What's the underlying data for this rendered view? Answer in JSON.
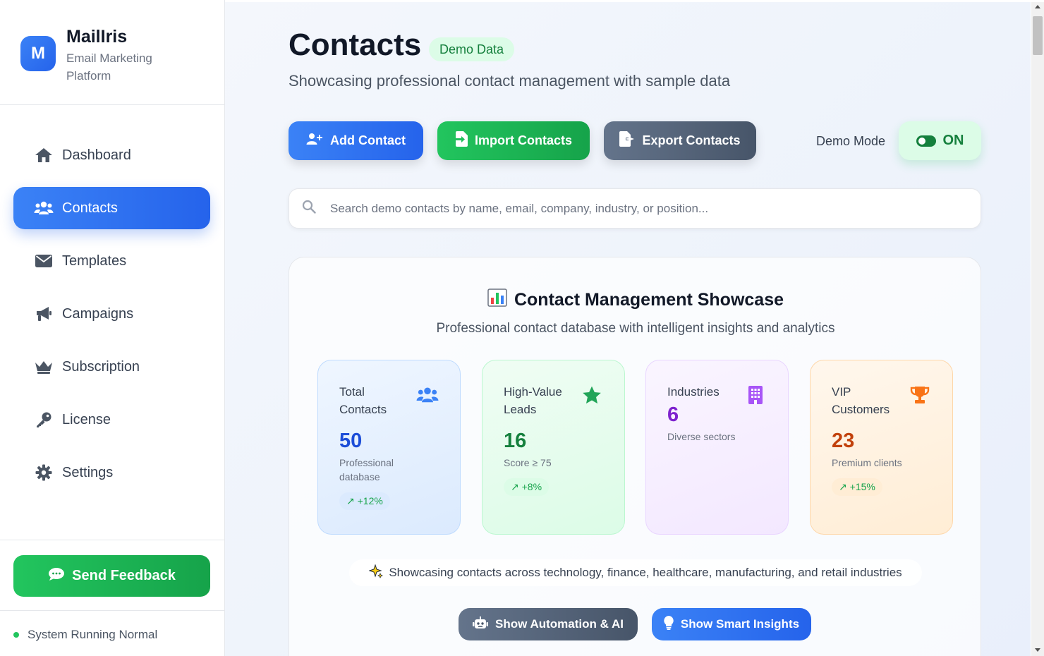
{
  "brand": {
    "logo_letter": "M",
    "name": "MailIris",
    "subtitle": "Email Marketing Platform"
  },
  "sidebar": {
    "items": [
      {
        "label": "Dashboard",
        "icon": "home-icon",
        "active": false
      },
      {
        "label": "Contacts",
        "icon": "users-icon",
        "active": true
      },
      {
        "label": "Templates",
        "icon": "envelope-icon",
        "active": false
      },
      {
        "label": "Campaigns",
        "icon": "megaphone-icon",
        "active": false
      },
      {
        "label": "Subscription",
        "icon": "crown-icon",
        "active": false
      },
      {
        "label": "License",
        "icon": "key-icon",
        "active": false
      },
      {
        "label": "Settings",
        "icon": "gear-icon",
        "active": false
      }
    ],
    "feedback_label": "Send Feedback",
    "status_text": "System Running Normal",
    "status_color": "#22c55e"
  },
  "header": {
    "title": "Contacts",
    "badge": "Demo Data",
    "subtitle": "Showcasing professional contact management with sample data"
  },
  "toolbar": {
    "add_label": "Add Contact",
    "import_label": "Import Contacts",
    "export_label": "Export Contacts",
    "demo_mode_label": "Demo Mode",
    "demo_mode_state": "ON"
  },
  "search": {
    "placeholder": "Search demo contacts by name, email, company, industry, or position...",
    "value": ""
  },
  "showcase": {
    "title": "Contact Management Showcase",
    "subtitle": "Professional contact database with intelligent insights and analytics",
    "stats": [
      {
        "label": "Total Contacts",
        "value": "50",
        "desc": "Professional database",
        "change": "↗ +12%",
        "icon": "users-icon",
        "color": "#1d4ed8"
      },
      {
        "label": "High-Value Leads",
        "value": "16",
        "desc": "Score ≥ 75",
        "change": "↗ +8%",
        "icon": "star-icon",
        "color": "#15803d"
      },
      {
        "label": "Industries",
        "value": "6",
        "desc": "Diverse sectors",
        "change": "",
        "icon": "building-icon",
        "color": "#7e22ce"
      },
      {
        "label": "VIP Customers",
        "value": "23",
        "desc": "Premium clients",
        "change": "↗ +15%",
        "icon": "trophy-icon",
        "color": "#c2410c"
      }
    ],
    "note": "Showcasing contacts across technology, finance, healthcare, manufacturing, and retail industries",
    "automation_label": "Show Automation & AI",
    "insights_label": "Show Smart Insights"
  }
}
